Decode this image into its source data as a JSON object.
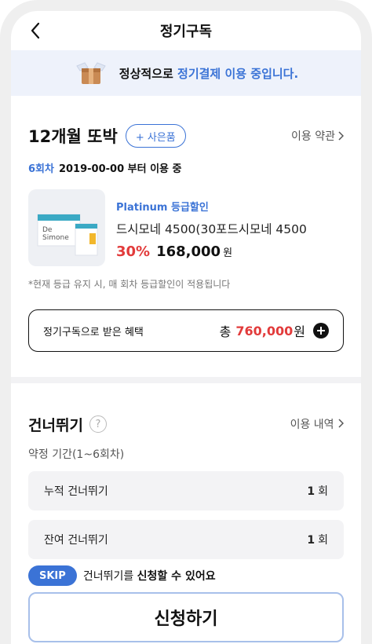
{
  "header": {
    "title": "정기구독"
  },
  "banner": {
    "text_before": "정상적으로 ",
    "accent": "정기결제 이용 중입니다."
  },
  "plan": {
    "name": "12개월 또박",
    "gift_label": "+ 사은품",
    "terms_label": "이용 약관",
    "count": "6회차",
    "since": "2019-00-00 부터 이용 중"
  },
  "product": {
    "grade": "Platinum 등급할인",
    "name": "드시모네 4500(30포드시모네 4500",
    "discount": "30%",
    "price": "168,000",
    "currency": "원",
    "image_brand_line1": "De",
    "image_brand_line2": "Simone"
  },
  "notice": "*현재 등급 유지 시, 매 회차 등급할인이 적용됩니다",
  "benefit": {
    "label": "정기구독으로 받은 혜택",
    "total_prefix": "총",
    "amount": "760,000",
    "currency": "원"
  },
  "skip": {
    "title": "건너뛰기",
    "help": "?",
    "history_label": "이용 내역",
    "term": "약정 기간(1~6회차)",
    "stats": [
      {
        "label": "누적 건너뛰기",
        "value": "1",
        "unit": "회"
      },
      {
        "label": "잔여 건너뛰기",
        "value": "1",
        "unit": "회"
      }
    ],
    "badge": "SKIP",
    "promo_before": "건너뛰기를 ",
    "promo_bold": "신청할 수 있어요",
    "apply_label": "신청하기"
  },
  "colors": {
    "accent": "#3b73d6",
    "discount": "#e23b3b",
    "banner_bg": "#eef2fb"
  }
}
